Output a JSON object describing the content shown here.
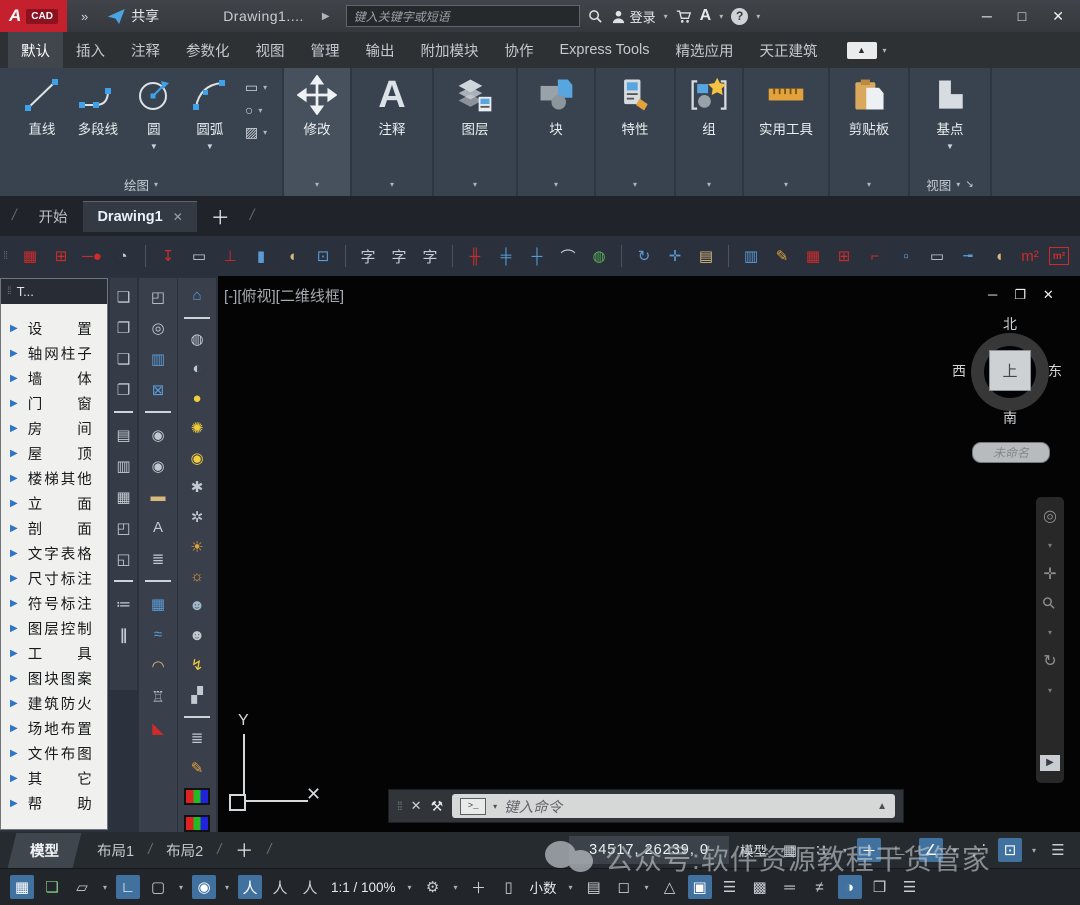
{
  "colors": {
    "autocad_red": "#c5202e",
    "accent_blue": "#3fa2e8",
    "ribbon_bg": "#39424f",
    "palette_bg": "#f0f0ee",
    "canvas_bg": "#040404",
    "status_highlight": "#41719e",
    "tool_red": "#cf2b2b",
    "tool_tan": "#d9b87c",
    "tool_orange": "#e2a23c"
  },
  "ui": {
    "tri_right": "▶",
    "caret_sm": "▾",
    "caret_down": "▼",
    "slash": "/",
    "grip": "⁞⁞",
    "launcher": "↘"
  },
  "titlebar": {
    "logo_a": "A",
    "logo_cad": "CAD",
    "expand": "»",
    "share_label": "共享",
    "doc_title": "Drawing1....",
    "nav_tri": "▶",
    "search_placeholder": "键入关键字或短语",
    "login_label": "登录",
    "help_glyph": "?",
    "autodesk_glyph": "A",
    "win_min": "─",
    "win_max": "□",
    "win_close": "✕"
  },
  "ribbon": {
    "tabs": [
      {
        "label": "默认",
        "cls": "active",
        "name": "tab-default"
      },
      {
        "label": "插入",
        "name": "tab-insert"
      },
      {
        "label": "注释",
        "name": "tab-annotate"
      },
      {
        "label": "参数化",
        "name": "tab-parametric"
      },
      {
        "label": "视图",
        "name": "tab-view"
      },
      {
        "label": "管理",
        "name": "tab-manage"
      },
      {
        "label": "输出",
        "name": "tab-output"
      },
      {
        "label": "附加模块",
        "name": "tab-addins"
      },
      {
        "label": "协作",
        "name": "tab-collaborate"
      },
      {
        "label": "Express Tools",
        "name": "tab-express-tools"
      },
      {
        "label": "精选应用",
        "name": "tab-featured-apps"
      },
      {
        "label": "天正建筑",
        "name": "tab-tangent-tarch"
      }
    ],
    "collapse_glyph": "▲",
    "draw": {
      "line": "直线",
      "polyline": "多段线",
      "circle": "圆",
      "arc": "圆弧",
      "rect_glyph": "▭",
      "ellipse_glyph": "○",
      "hatch_glyph": "▨",
      "panel_label": "绘图"
    },
    "modify_label": "修改",
    "annotate_label": "注释",
    "annotate_glyph": "A",
    "layers_label": "图层",
    "block_label": "块",
    "properties_label": "特性",
    "group_label": "组",
    "utilities_label": "实用工具",
    "clipboard_label": "剪贴板",
    "basepoint_label": "基点",
    "view_panel_label": "视图"
  },
  "file_tabs": {
    "start": "开始",
    "drawing": "Drawing1",
    "close": "✕",
    "plus": "＋"
  },
  "tz_toolbar": {
    "icons": [
      {
        "g": "▦",
        "cls": "r",
        "name": "axis-grid-icon"
      },
      {
        "g": "⊞",
        "cls": "r",
        "name": "standard-column-icon"
      },
      {
        "g": "─●",
        "cls": "r",
        "name": "wall-endpoint-icon"
      },
      {
        "g": "◔",
        "cls": "g",
        "name": "sketch-circle-icon"
      },
      {
        "cls": "sep",
        "name": "separator"
      },
      {
        "g": "↧",
        "cls": "r",
        "name": "draw-wall-icon"
      },
      {
        "g": "▭",
        "cls": "g",
        "name": "wall-section-icon"
      },
      {
        "g": "⊥",
        "cls": "r",
        "name": "wall-base-icon"
      },
      {
        "g": "▮",
        "cls": "b",
        "name": "door-icon"
      },
      {
        "g": "◖",
        "cls": "t",
        "name": "arc-door-icon"
      },
      {
        "g": "⊡",
        "cls": "b",
        "name": "window-icon"
      },
      {
        "cls": "sep",
        "name": "separator"
      },
      {
        "g": "字",
        "cls": "g",
        "name": "text-style-icon"
      },
      {
        "g": "字",
        "cls": "g",
        "name": "single-text-icon"
      },
      {
        "g": "字",
        "cls": "g",
        "name": "multi-text-icon"
      },
      {
        "cls": "sep",
        "name": "separator"
      },
      {
        "g": "╫",
        "cls": "r",
        "name": "dim-axis-icon"
      },
      {
        "g": "╪",
        "cls": "b",
        "name": "dim-two-point-icon"
      },
      {
        "g": "┼",
        "cls": "b",
        "name": "dim-chain-icon"
      },
      {
        "g": "⌒",
        "cls": "g",
        "name": "dim-arc-icon"
      },
      {
        "g": "◍",
        "cls": "grn",
        "name": "dim-update-icon"
      },
      {
        "cls": "sep",
        "name": "separator"
      },
      {
        "g": "↻",
        "cls": "b",
        "name": "rotate-copy-icon"
      },
      {
        "g": "✛",
        "cls": "b",
        "name": "move-tool-icon"
      },
      {
        "g": "▤",
        "cls": "t",
        "name": "paste-clipboard-icon"
      },
      {
        "cls": "sep",
        "name": "separator"
      },
      {
        "g": "▥",
        "cls": "b",
        "name": "column-edit-icon"
      },
      {
        "g": "✎",
        "cls": "o",
        "name": "inplace-edit-icon"
      },
      {
        "g": "▦",
        "cls": "r",
        "name": "axis-grid-2-icon"
      },
      {
        "g": "⊞",
        "cls": "r",
        "name": "column-2-icon"
      },
      {
        "g": "⌐",
        "cls": "r",
        "name": "corner-column-icon"
      },
      {
        "g": "▫",
        "cls": "b",
        "name": "construction-column-icon"
      },
      {
        "g": "▭",
        "cls": "g",
        "name": "wall-2-icon"
      },
      {
        "g": "╼",
        "cls": "b",
        "name": "line-to-wall-icon"
      },
      {
        "g": "◖",
        "cls": "t",
        "name": "arc-window-icon"
      },
      {
        "g": "m²",
        "cls": "r",
        "name": "area-icon"
      },
      {
        "g": "m²",
        "cls": "r bx",
        "name": "area-frame-icon"
      }
    ]
  },
  "left_menu": {
    "title": "T...",
    "items": [
      {
        "label": "设置",
        "name": "menu-settings"
      },
      {
        "label": "轴网柱子",
        "name": "menu-axis-grid-column"
      },
      {
        "label": "墙体",
        "name": "menu-wall"
      },
      {
        "label": "门窗",
        "name": "menu-door-window"
      },
      {
        "label": "房间",
        "name": "menu-room"
      },
      {
        "label": "屋顶",
        "name": "menu-roof"
      },
      {
        "label": "楼梯其他",
        "name": "menu-stairs-other"
      },
      {
        "label": "立面",
        "name": "menu-elevation"
      },
      {
        "label": "剖面",
        "name": "menu-section"
      },
      {
        "label": "文字表格",
        "name": "menu-text-table"
      },
      {
        "label": "尺寸标注",
        "name": "menu-dimension"
      },
      {
        "label": "符号标注",
        "name": "menu-symbol-annotation"
      },
      {
        "label": "图层控制",
        "name": "menu-layer-control"
      },
      {
        "label": "工具",
        "name": "menu-tools"
      },
      {
        "label": "图块图案",
        "name": "menu-block-pattern"
      },
      {
        "label": "建筑防火",
        "name": "menu-fire-protection"
      },
      {
        "label": "场地布置",
        "name": "menu-site-layout"
      },
      {
        "label": "文件布图",
        "name": "menu-file-layout"
      },
      {
        "label": "其它",
        "name": "menu-other"
      },
      {
        "label": "帮助",
        "name": "menu-help"
      }
    ]
  },
  "strip1": {
    "icons": [
      {
        "g": "❏",
        "name": "overlap-layer-a-icon"
      },
      {
        "g": "❐",
        "name": "overlap-layer-b-icon"
      },
      {
        "g": "❏",
        "name": "overlap-layer-c-icon"
      },
      {
        "g": "❐",
        "name": "overlap-layer-d-icon"
      },
      {
        "cls": "hr",
        "name": "divider"
      },
      {
        "g": "▤",
        "name": "bar-top-icon"
      },
      {
        "g": "▥",
        "name": "bar-mid-icon"
      },
      {
        "g": "▦",
        "name": "grid-square-icon"
      },
      {
        "g": "◰",
        "name": "block-left-icon"
      },
      {
        "g": "◱",
        "name": "block-low-icon"
      },
      {
        "cls": "hr",
        "name": "divider"
      },
      {
        "g": "≔",
        "name": "list-pair-icon"
      },
      {
        "g": "∥",
        "cls": "it",
        "name": "parallel-lines-icon"
      }
    ]
  },
  "strip2": {
    "icons": [
      {
        "g": "◰",
        "name": "doc-stamp-icon"
      },
      {
        "g": "◎",
        "name": "doc-preview-icon"
      },
      {
        "g": "▥",
        "cls": "b",
        "name": "column-table-icon"
      },
      {
        "g": "⊠",
        "cls": "b",
        "name": "mail-block-icon"
      },
      {
        "cls": "hr",
        "name": "divider"
      },
      {
        "g": "◉",
        "name": "pin-a-icon"
      },
      {
        "g": "◉",
        "name": "pin-b-icon"
      },
      {
        "g": "▬",
        "cls": "t",
        "name": "wall-hatch-icon"
      },
      {
        "g": "A",
        "name": "wire-text-icon"
      },
      {
        "g": "≣",
        "name": "stack-lines-icon"
      },
      {
        "cls": "hr",
        "name": "divider"
      },
      {
        "g": "▦",
        "cls": "b",
        "name": "grid-dialog-icon"
      },
      {
        "g": "≈",
        "cls": "b",
        "name": "wave-icon"
      },
      {
        "g": "◠",
        "cls": "t",
        "name": "arch-icon"
      },
      {
        "g": "♖",
        "name": "tower-icon"
      },
      {
        "g": "◣",
        "cls": "r",
        "name": "vehicle-icon"
      }
    ]
  },
  "strip3": {
    "icons": [
      {
        "g": "⌂",
        "cls": "b",
        "name": "house-info-icon"
      },
      {
        "cls": "hr",
        "name": "divider"
      },
      {
        "g": "◍",
        "name": "bulb-dim-icon"
      },
      {
        "g": "◐",
        "name": "bulb-half-icon"
      },
      {
        "g": "●",
        "cls": "y",
        "name": "bulb-on-icon"
      },
      {
        "g": "✺",
        "cls": "y",
        "name": "bulb-burst-icon"
      },
      {
        "g": "◉",
        "cls": "y",
        "name": "bulb-pair-icon"
      },
      {
        "g": "✱",
        "name": "snowflake-icon"
      },
      {
        "g": "✲",
        "name": "snowflake-page-icon"
      },
      {
        "g": "☀",
        "cls": "o",
        "name": "sun-icon"
      },
      {
        "g": "☼",
        "cls": "o",
        "name": "sun-rotate-icon"
      },
      {
        "g": "☻",
        "cls": "bl",
        "name": "figure-a-icon"
      },
      {
        "g": "☻",
        "name": "figure-b-icon"
      },
      {
        "g": "↯",
        "cls": "y",
        "name": "lightning-icon"
      },
      {
        "g": "▞",
        "name": "machine-icon"
      },
      {
        "cls": "hr",
        "name": "divider"
      },
      {
        "g": "≣",
        "name": "layer-stack-icon"
      },
      {
        "g": "✎",
        "cls": "o",
        "name": "layer-edit-icon"
      },
      {
        "cls": "cb",
        "name": "color-bar-a-icon"
      },
      {
        "cls": "cb",
        "name": "color-bar-b-icon"
      }
    ]
  },
  "canvas": {
    "viewport_label": "[-][俯视][二维线框]",
    "vp_min": "─",
    "vp_restore": "❐",
    "vp_close": "✕",
    "viewcube": {
      "north": "北",
      "south": "南",
      "west": "西",
      "east": "东",
      "top": "上",
      "wcs_label": "未命名"
    },
    "ucs": {
      "y_label": "Y",
      "x_marker": "✕"
    },
    "navbar_icons": [
      {
        "g": "◎",
        "name": "nav-wheel-icon"
      },
      {
        "g": "▾",
        "cls": "car",
        "name": "nav-wheel-caret"
      },
      {
        "g": "✛",
        "name": "pan-icon"
      },
      {
        "g": "⚲",
        "cls": "rot",
        "name": "zoom-icon"
      },
      {
        "g": "▾",
        "cls": "car",
        "name": "zoom-caret"
      },
      {
        "g": "↻",
        "name": "orbit-icon"
      },
      {
        "g": "▾",
        "cls": "car",
        "name": "orbit-caret"
      },
      {
        "g": "▶",
        "cls": "lt",
        "name": "showmotion-icon"
      }
    ]
  },
  "command_bar": {
    "grip": "⁞⁞",
    "close": "✕",
    "wrench": "⚒",
    "prompt_glyph": ">_",
    "caret": "▾",
    "placeholder": "键入命令",
    "expand": "▲"
  },
  "status_row1": {
    "model_tab": "模型",
    "layout1": "布局1",
    "layout2": "布局2",
    "plus": "＋",
    "coords": "34517, 26239, 0",
    "model_btn": "模型",
    "icons": [
      {
        "g": "▦",
        "name": "grid-display-icon"
      },
      {
        "g": "∷",
        "name": "snap-mode-icon"
      },
      {
        "g": "▾",
        "cls": "car",
        "name": "snap-caret"
      },
      {
        "g": "＋",
        "cls": "on",
        "name": "dynamic-input-icon"
      },
      {
        "g": "∟",
        "name": "ortho-icon"
      },
      {
        "g": "∠",
        "cls": "on",
        "name": "polar-tracking-icon"
      },
      {
        "g": "▾",
        "cls": "car",
        "name": "polar-caret"
      },
      {
        "g": "⋰",
        "name": "osnap-tracking-icon"
      },
      {
        "g": "⊡",
        "cls": "on",
        "name": "object-snap-icon"
      },
      {
        "g": "▾",
        "cls": "car",
        "name": "osnap-caret"
      },
      {
        "g": "☰",
        "name": "lines-icon"
      }
    ]
  },
  "watermark": {
    "text": "公众号:软件资源教程干货管家"
  },
  "status_row2": {
    "icons": [
      {
        "g": "▦",
        "cls": "on",
        "name": "grid-pattern-icon"
      },
      {
        "g": "❏",
        "cls": "grn",
        "name": "snap-toggle-icon"
      },
      {
        "g": "▱",
        "name": "iso-drafting-icon"
      },
      {
        "g": "▾",
        "cls": "car",
        "name": "iso-caret"
      },
      {
        "g": "∟",
        "cls": "on",
        "name": "ucs-toggle-icon"
      },
      {
        "g": "▢",
        "name": "selection-cycling-icon"
      },
      {
        "g": "▾",
        "cls": "car",
        "name": "selection-caret"
      },
      {
        "g": "◉",
        "cls": "on",
        "name": "gizmo-icon"
      },
      {
        "g": "▾",
        "cls": "car",
        "name": "gizmo-caret"
      },
      {
        "g": "人",
        "cls": "on",
        "name": "annotation-visibility-icon"
      },
      {
        "g": "人",
        "name": "annotation-autoscale-icon"
      },
      {
        "g": "人",
        "name": "annotation-scale-icon"
      },
      {
        "g": "1:1 / 100%",
        "cls": "txt",
        "name": "annotation-scale-value"
      },
      {
        "g": "▾",
        "cls": "car",
        "name": "scale-caret"
      },
      {
        "g": "⚙",
        "name": "workspace-gear-icon"
      },
      {
        "g": "▾",
        "cls": "car",
        "name": "workspace-caret"
      },
      {
        "g": "＋",
        "name": "add-status-icon"
      },
      {
        "g": "▯",
        "name": "units-ruler-icon"
      },
      {
        "g": "小数",
        "cls": "txt",
        "name": "units-label"
      },
      {
        "g": "▾",
        "cls": "car",
        "name": "units-caret"
      },
      {
        "g": "▤",
        "name": "quick-properties-icon"
      },
      {
        "g": "◻",
        "name": "lock-ui-icon"
      },
      {
        "g": "▾",
        "cls": "car",
        "name": "lock-caret"
      },
      {
        "g": "△",
        "name": "isolate-objects-icon"
      },
      {
        "g": "▣",
        "cls": "on",
        "name": "hardware-accel-icon"
      },
      {
        "g": "☰",
        "name": "lineweight-icon"
      },
      {
        "g": "▩",
        "name": "hatch-transparency-icon"
      },
      {
        "g": "═",
        "name": "selection-filter-icon"
      },
      {
        "g": "≠",
        "name": "tilt-lines-icon"
      },
      {
        "g": "◑",
        "cls": "on",
        "name": "clean-screen-icon"
      },
      {
        "g": "❒",
        "name": "fullscreen-icon"
      },
      {
        "g": "☰",
        "name": "customize-icon"
      }
    ]
  }
}
